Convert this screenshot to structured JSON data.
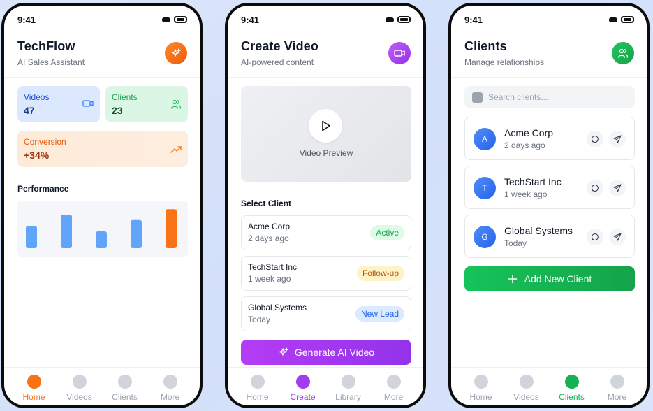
{
  "status": {
    "time": "9:41"
  },
  "colors": {
    "home_accent": "#f97316",
    "create_accent": "#a23cf0",
    "clients_accent": "#16b251",
    "bar_blue": "#60a5fa",
    "bar_orange": "#f97316"
  },
  "home": {
    "title": "TechFlow",
    "subtitle": "AI Sales Assistant",
    "header_icon": "sparkles-icon",
    "stats": {
      "videos": {
        "label": "Videos",
        "value": "47",
        "icon": "video-camera-icon"
      },
      "clients": {
        "label": "Clients",
        "value": "23",
        "icon": "users-icon"
      },
      "conversion": {
        "label": "Conversion",
        "value": "+34%",
        "icon": "trending-up-icon"
      }
    },
    "performance_title": "Performance",
    "performance_bars": [
      0.53,
      0.8,
      0.4,
      0.67,
      0.93
    ],
    "nav": [
      "Home",
      "Videos",
      "Clients",
      "More"
    ],
    "nav_active": 0
  },
  "create": {
    "title": "Create Video",
    "subtitle": "AI-powered content",
    "header_icon": "video-camera-icon",
    "preview_label": "Video Preview",
    "select_client_label": "Select Client",
    "clients": [
      {
        "name": "Acme Corp",
        "time": "2 days ago",
        "badge": "Active"
      },
      {
        "name": "TechStart Inc",
        "time": "1 week ago",
        "badge": "Follow-up"
      },
      {
        "name": "Global Systems",
        "time": "Today",
        "badge": "New Lead"
      }
    ],
    "generate_label": "Generate AI Video",
    "nav": [
      "Home",
      "Create",
      "Library",
      "More"
    ],
    "nav_active": 1
  },
  "clients": {
    "title": "Clients",
    "subtitle": "Manage relationships",
    "header_icon": "users-icon",
    "search_placeholder": "Search clients...",
    "list": [
      {
        "initial": "A",
        "name": "Acme Corp",
        "time": "2 days ago"
      },
      {
        "initial": "T",
        "name": "TechStart Inc",
        "time": "1 week ago"
      },
      {
        "initial": "G",
        "name": "Global Systems",
        "time": "Today"
      }
    ],
    "add_label": "Add New Client",
    "nav": [
      "Home",
      "Videos",
      "Clients",
      "More"
    ],
    "nav_active": 2
  }
}
